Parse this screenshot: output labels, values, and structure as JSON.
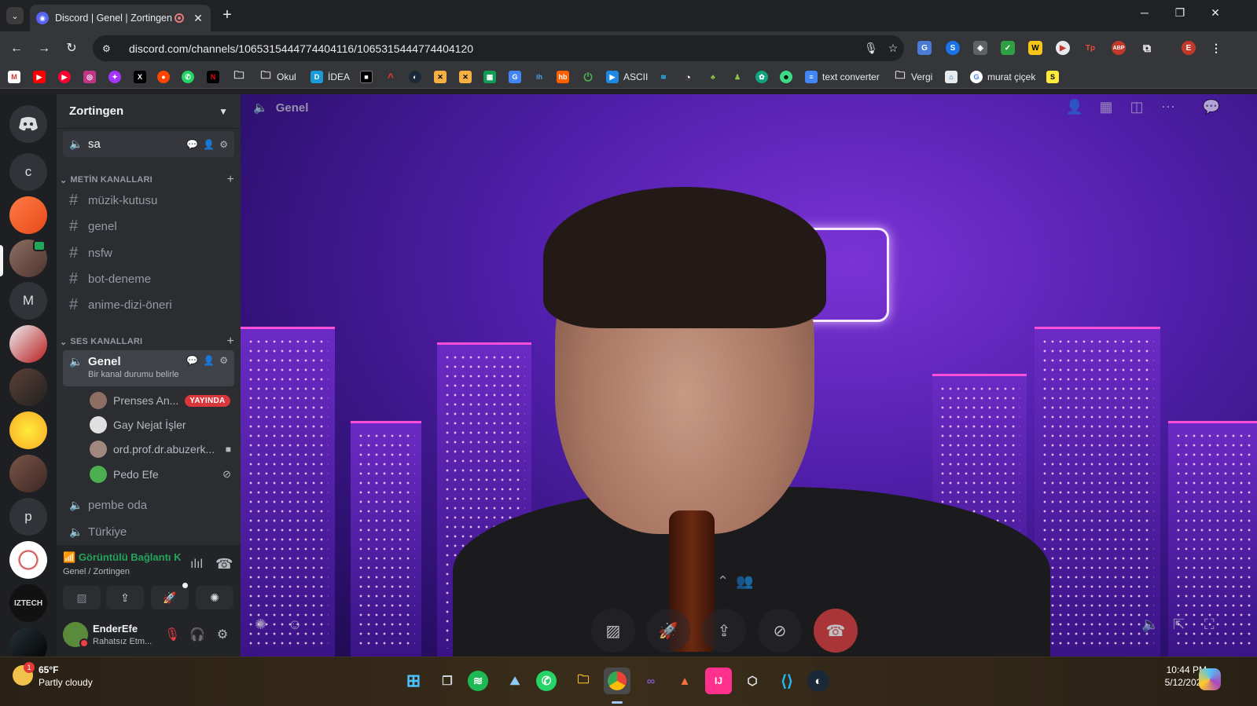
{
  "browser": {
    "tab_title": "Discord | Genel | Zortingen",
    "url": "discord.com/channels/1065315444774404116/1065315444774404120",
    "bookmarks": [
      "Okul",
      "İDEA",
      "ASCII",
      "text converter",
      "Vergi",
      "murat çiçek"
    ]
  },
  "discord": {
    "server_name": "Zortingen",
    "top_channel": "sa",
    "text_category": "METİN KANALLARI",
    "text_channels": [
      "müzik-kutusu",
      "genel",
      "nsfw",
      "bot-deneme",
      "anime-dizi-öneri"
    ],
    "voice_category": "SES KANALLARI",
    "voice_channels": {
      "selected": "Genel",
      "selected_status": "Bir kanal durumu belirle",
      "others": [
        "pembe oda",
        "Türkiye"
      ]
    },
    "voice_users": [
      {
        "name": "Prenses An...",
        "badge": "YAYINDA"
      },
      {
        "name": "Gay Nejat İşler"
      },
      {
        "name": "ord.prof.dr.abuzerk..."
      },
      {
        "name": "Pedo Efe"
      }
    ],
    "connection": {
      "status": "Görüntülü Bağlantı Kı",
      "location": "Genel / Zortingen"
    },
    "user": {
      "name": "EnderEfe",
      "status": "Rahatsız Etm..."
    },
    "stage_title": "Genel",
    "guild_letters": [
      "c",
      "M",
      "p"
    ]
  },
  "taskbar": {
    "weather_temp": "65°F",
    "weather_desc": "Partly cloudy",
    "weather_badge": "1",
    "time": "10:44 PM",
    "date": "5/12/2024"
  },
  "colors": {
    "accent": "#5865f2",
    "online_green": "#23a55a",
    "dnd_red": "#f23f43",
    "live_red": "#da373c"
  }
}
